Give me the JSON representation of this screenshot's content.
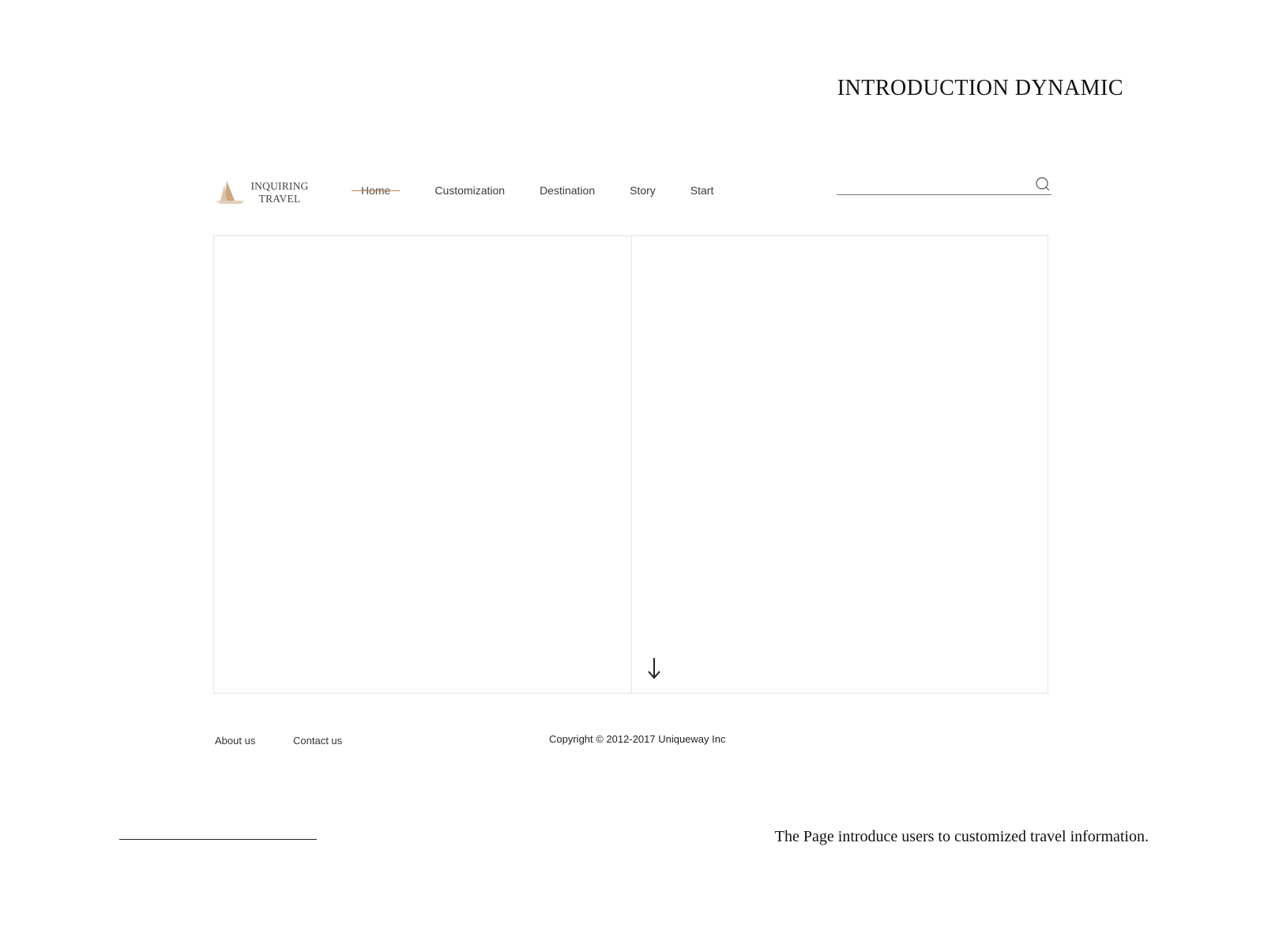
{
  "page": {
    "title": "INTRODUCTION DYNAMIC",
    "caption": "The Page introduce users to customized travel information."
  },
  "logo": {
    "line1": "INQUIRING",
    "line2": "TRAVEL",
    "icon": "sailboat-icon",
    "color": "#c9a882"
  },
  "nav": {
    "items": [
      {
        "label": "Home",
        "active": true
      },
      {
        "label": "Customization",
        "active": false
      },
      {
        "label": "Destination",
        "active": false
      },
      {
        "label": "Story",
        "active": false
      },
      {
        "label": "Start",
        "active": false
      }
    ],
    "active_color": "#b68a6a"
  },
  "search": {
    "value": "",
    "placeholder": "",
    "icon": "search-icon"
  },
  "content": {
    "scroll_icon": "arrow-down-icon"
  },
  "footer": {
    "about_label": "About us",
    "contact_label": "Contact us",
    "copyright": "Copyright © 2012-2017 Uniqueway Inc"
  }
}
